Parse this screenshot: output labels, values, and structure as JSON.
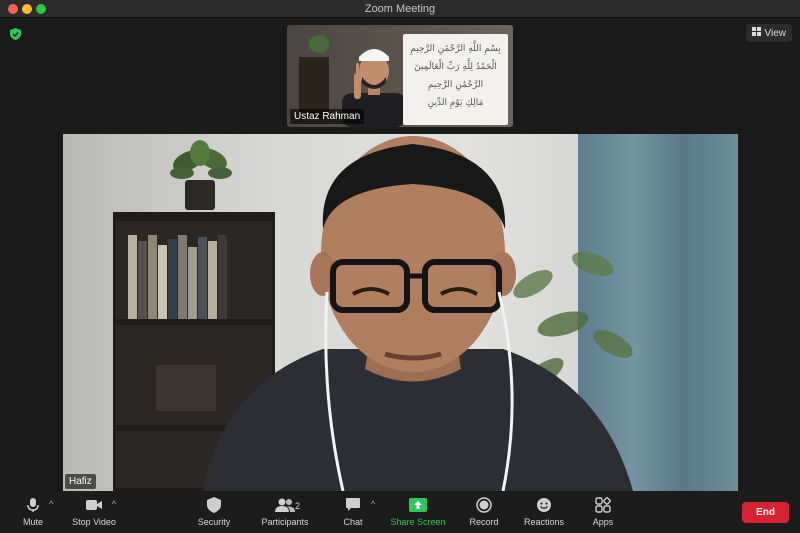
{
  "window": {
    "title": "Zoom Meeting"
  },
  "top": {
    "view_label": "View"
  },
  "thumbnail": {
    "participant_name": "Ustaz Rahman",
    "whiteboard_lines": [
      "بِسْمِ اللَّهِ الرَّحْمَٰنِ الرَّحِيمِ",
      "الْحَمْدُ لِلَّهِ رَبِّ الْعَالَمِينَ",
      "الرَّحْمَٰنِ الرَّحِيمِ",
      "مَالِكِ يَوْمِ الدِّينِ"
    ]
  },
  "main": {
    "participant_name": "Hafiz"
  },
  "toolbar": {
    "mute": "Mute",
    "stop_video": "Stop Video",
    "security": "Security",
    "participants": "Participants",
    "participants_count": "2",
    "chat": "Chat",
    "share_screen": "Share Screen",
    "record": "Record",
    "reactions": "Reactions",
    "apps": "Apps",
    "end": "End"
  },
  "colors": {
    "share_green": "#2fc55a",
    "end_red": "#d5242f",
    "security_green": "#2fc55a"
  }
}
